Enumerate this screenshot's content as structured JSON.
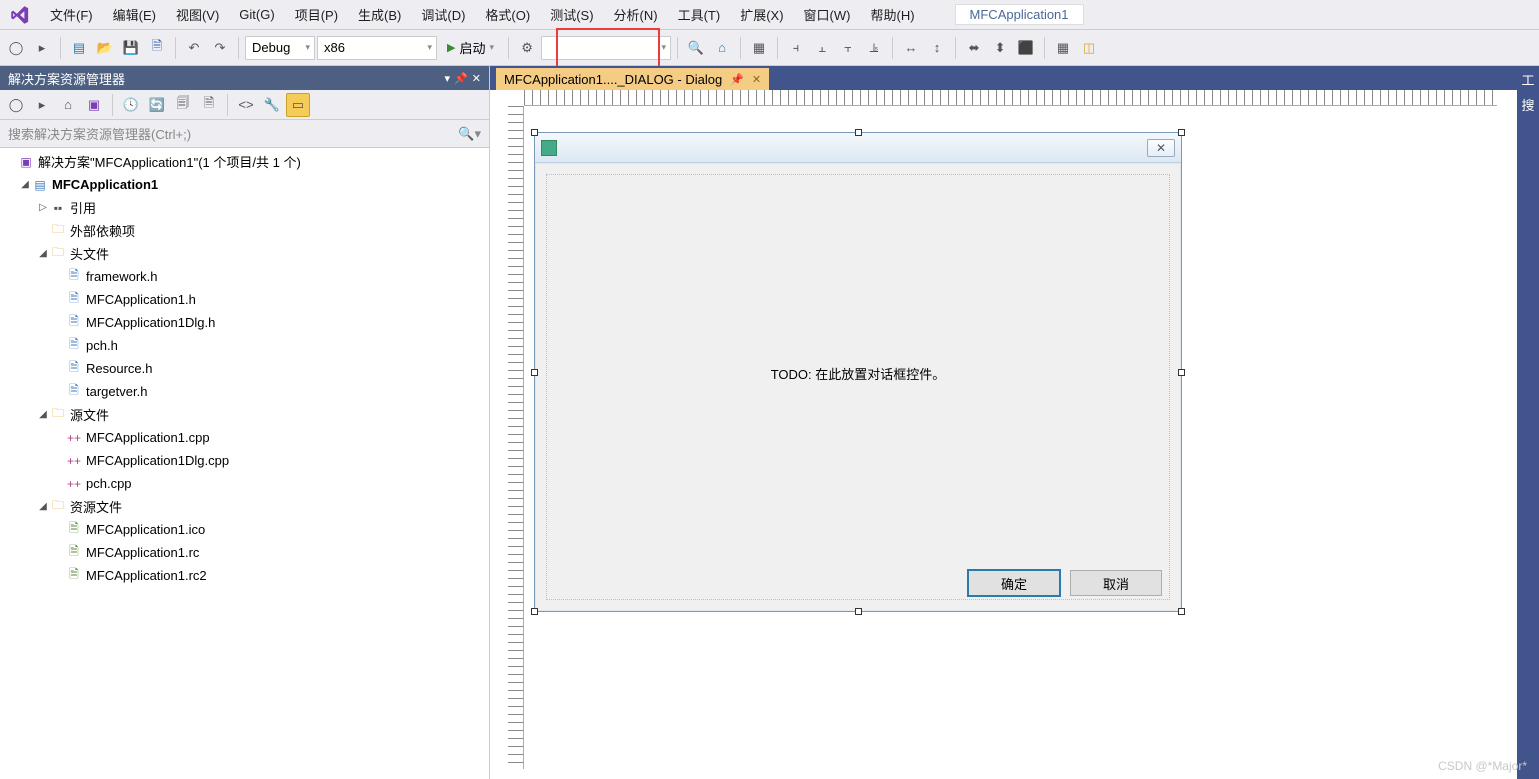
{
  "app_title": "MFCApplication1",
  "menu": [
    "文件(F)",
    "编辑(E)",
    "视图(V)",
    "Git(G)",
    "项目(P)",
    "生成(B)",
    "调试(D)",
    "格式(O)",
    "测试(S)",
    "分析(N)",
    "工具(T)",
    "扩展(X)",
    "窗口(W)",
    "帮助(H)"
  ],
  "toolbar": {
    "config": "Debug",
    "platform": "x86",
    "start_label": "启动"
  },
  "solution_explorer": {
    "title": "解决方案资源管理器",
    "search_placeholder": "搜索解决方案资源管理器(Ctrl+;)",
    "solution_label": "解决方案\"MFCApplication1\"(1 个项目/共 1 个)",
    "project": "MFCApplication1",
    "references": "引用",
    "external_deps": "外部依赖项",
    "headers_label": "头文件",
    "headers": [
      "framework.h",
      "MFCApplication1.h",
      "MFCApplication1Dlg.h",
      "pch.h",
      "Resource.h",
      "targetver.h"
    ],
    "sources_label": "源文件",
    "sources": [
      "MFCApplication1.cpp",
      "MFCApplication1Dlg.cpp",
      "pch.cpp"
    ],
    "resources_label": "资源文件",
    "resources": [
      "MFCApplication1.ico",
      "MFCApplication1.rc",
      "MFCApplication1.rc2"
    ]
  },
  "editor": {
    "tab_label": "MFCApplication1...._DIALOG - Dialog",
    "dialog": {
      "todo_text": "TODO: 在此放置对话框控件。",
      "ok_label": "确定",
      "cancel_label": "取消"
    }
  },
  "rightpanel": {
    "tool": "工",
    "search": "搜"
  },
  "watermark": "CSDN @*Major*"
}
